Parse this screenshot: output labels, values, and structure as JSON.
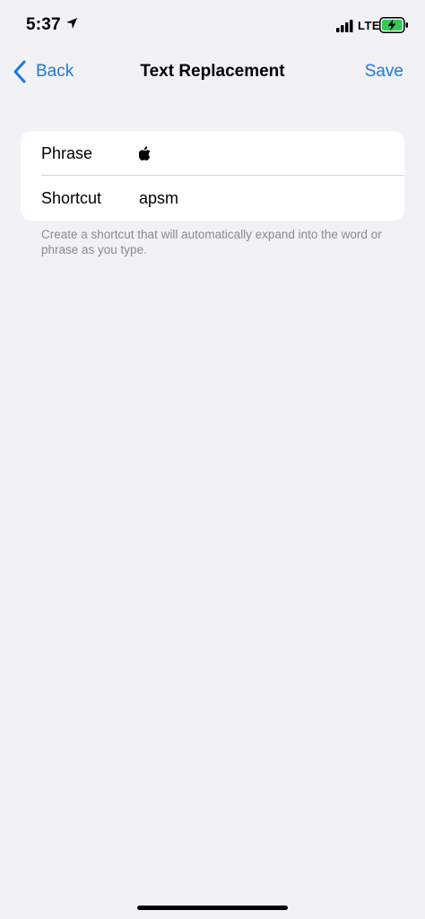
{
  "status_bar": {
    "time": "5:37",
    "network": "LTE"
  },
  "nav": {
    "back_label": "Back",
    "title": "Text Replacement",
    "save_label": "Save"
  },
  "form": {
    "phrase_label": "Phrase",
    "phrase_value": "",
    "shortcut_label": "Shortcut",
    "shortcut_value": "apsm"
  },
  "footer_note": "Create a shortcut that will automatically expand into the word or phrase as you type.",
  "colors": {
    "accent": "#1a7ae2",
    "background": "#f2f1f6",
    "battery_charge": "#34c759"
  }
}
